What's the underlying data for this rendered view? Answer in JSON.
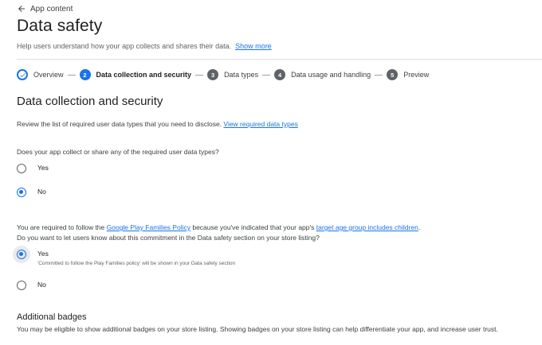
{
  "nav": {
    "back_label": "App content"
  },
  "header": {
    "title": "Data safety",
    "subtitle": "Help users understand how your app collects and shares their data.",
    "show_more": "Show more"
  },
  "stepper": [
    {
      "label": "Overview",
      "number": "",
      "state": "done"
    },
    {
      "label": "Data collection and security",
      "number": "2",
      "state": "active"
    },
    {
      "label": "Data types",
      "number": "3",
      "state": "todo"
    },
    {
      "label": "Data usage and handling",
      "number": "4",
      "state": "todo"
    },
    {
      "label": "Preview",
      "number": "5",
      "state": "todo"
    }
  ],
  "section": {
    "title": "Data collection and security",
    "intro": "Review the list of required user data types that you need to disclose.",
    "intro_link": "View required data types"
  },
  "q1": {
    "question": "Does your app collect or share any of the required user data types?",
    "options": [
      {
        "label": "Yes",
        "selected": false
      },
      {
        "label": "No",
        "selected": true
      }
    ]
  },
  "families": {
    "line1_a": "You are required to follow the ",
    "line1_link1": "Google Play Families Policy",
    "line1_b": " because you've indicated that your app's ",
    "line1_link2": "target age group includes children",
    "line1_c": ".",
    "line2": "Do you want to let users know about this commitment in the Data safety section on your store listing?",
    "options": [
      {
        "label": "Yes",
        "hint": "'Committed to follow the Play Families policy' will be shown in your Data safety section",
        "selected": true
      },
      {
        "label": "No",
        "selected": false
      }
    ]
  },
  "badges": {
    "title": "Additional badges",
    "text": "You may be eligible to show additional badges on your store listing. Showing badges on your store listing can help differentiate your app, and increase user trust."
  },
  "colors": {
    "accent": "#1a73e8",
    "text": "#202124",
    "muted": "#5f6368"
  }
}
